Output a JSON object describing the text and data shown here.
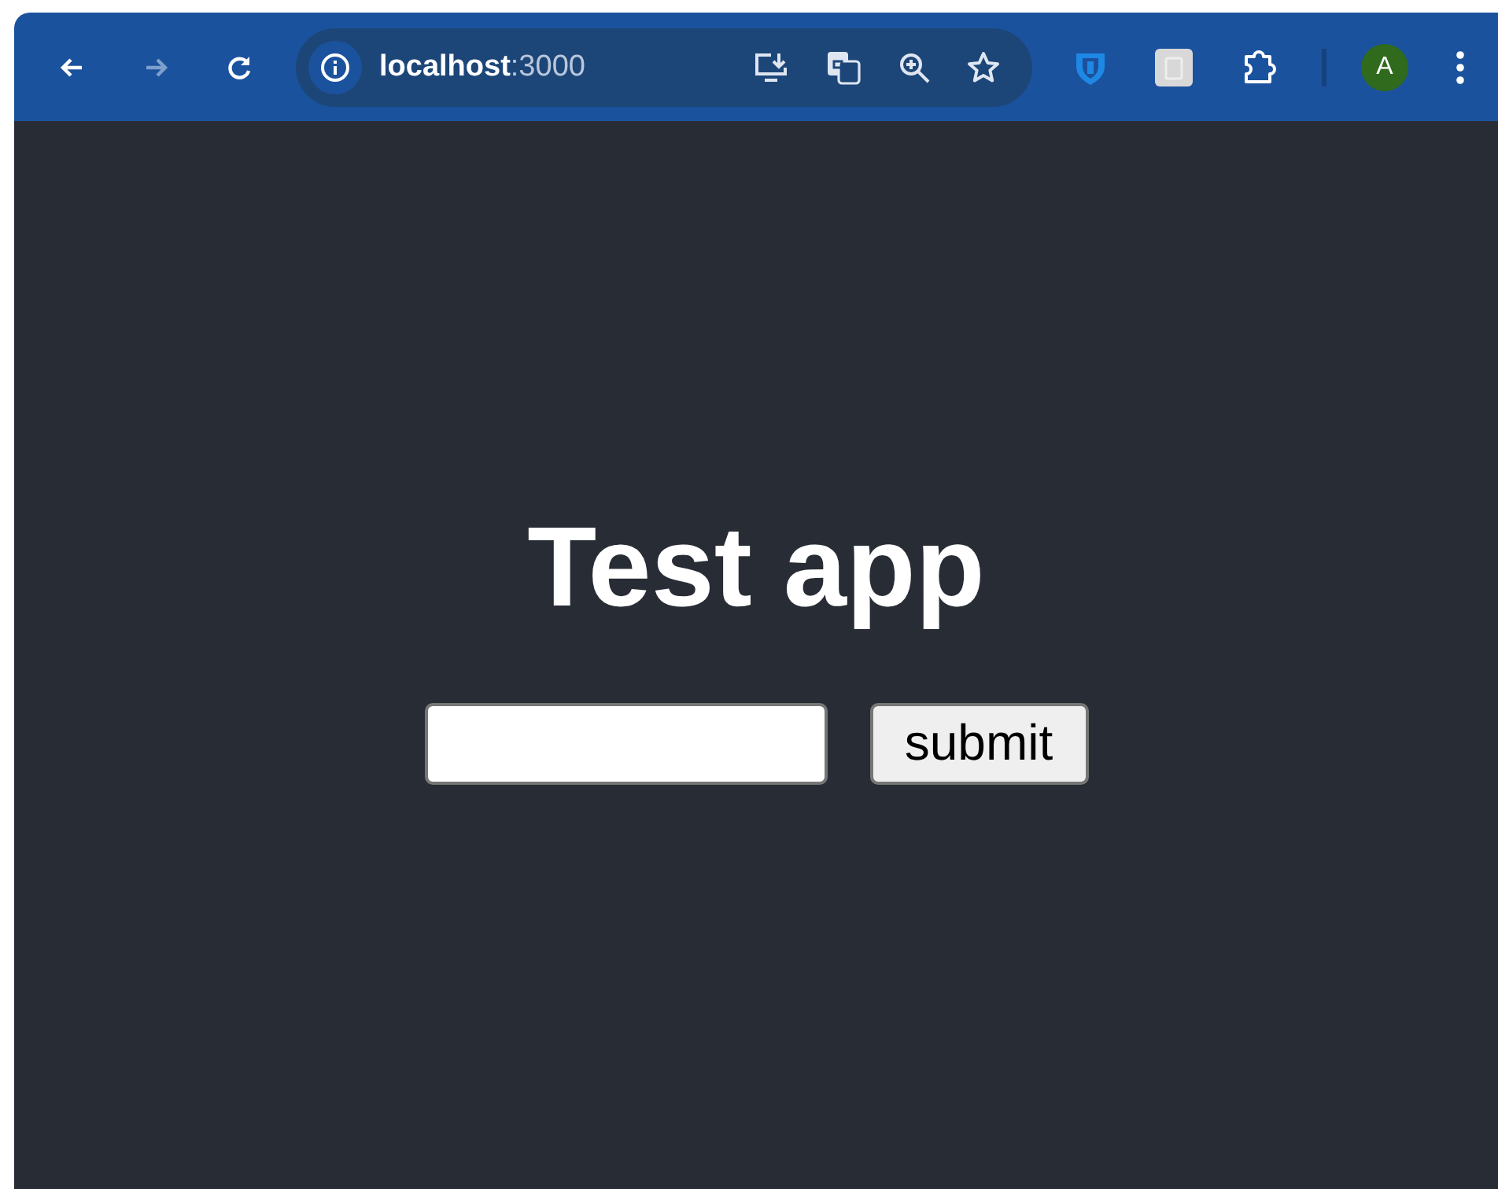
{
  "toolbar": {
    "nav_buttons": [
      {
        "kind": "back",
        "disabled": false
      },
      {
        "kind": "forward",
        "disabled": true
      },
      {
        "kind": "reload",
        "disabled": false
      }
    ],
    "address": {
      "host": "localhost",
      "port": ":3000"
    },
    "profile": {
      "initial": "A"
    }
  },
  "page": {
    "title": "Test app",
    "button": "submit"
  }
}
